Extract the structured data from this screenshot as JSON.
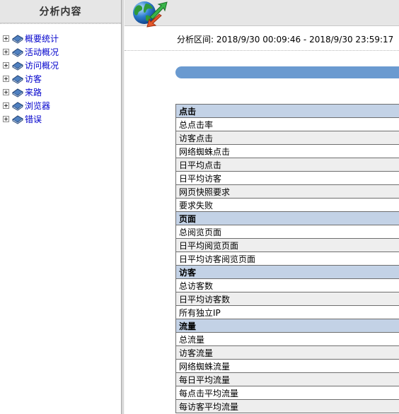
{
  "sidebar": {
    "title": "分析内容",
    "items": [
      {
        "label": "概要统计",
        "icon": "book-icon"
      },
      {
        "label": "活动概况",
        "icon": "book-icon"
      },
      {
        "label": "访问概况",
        "icon": "book-icon"
      },
      {
        "label": "访客",
        "icon": "book-icon"
      },
      {
        "label": "来路",
        "icon": "book-icon"
      },
      {
        "label": "浏览器",
        "icon": "book-icon"
      },
      {
        "label": "错误",
        "icon": "book-icon"
      }
    ]
  },
  "header": {
    "logo_icon": "globe-arrows-icon"
  },
  "period": {
    "label": "分析区间:",
    "range": "2018/9/30 00:09:46 - 2018/9/30 23:59:17"
  },
  "stats": {
    "sections": [
      {
        "title": "点击",
        "rows": [
          "总点击率",
          "访客点击",
          "网络蜘蛛点击",
          "日平均点击",
          "日平均访客",
          "网页快照要求",
          "要求失败"
        ]
      },
      {
        "title": "页面",
        "rows": [
          "总阅览页面",
          "日平均阅览页面",
          "日平均访客阅览页面"
        ]
      },
      {
        "title": "访客",
        "rows": [
          "总访客数",
          "日平均访客数",
          "所有独立IP"
        ]
      },
      {
        "title": "流量",
        "rows": [
          "总流量",
          "访客流量",
          "网络蜘蛛流量",
          "每日平均流量",
          "每点击平均流量",
          "每访客平均流量"
        ]
      }
    ]
  },
  "colors": {
    "section_header": "#c3d2e6",
    "alt_row": "#eeeeee",
    "blue_bar": "#6a9ad0",
    "link": "#0000cc"
  }
}
